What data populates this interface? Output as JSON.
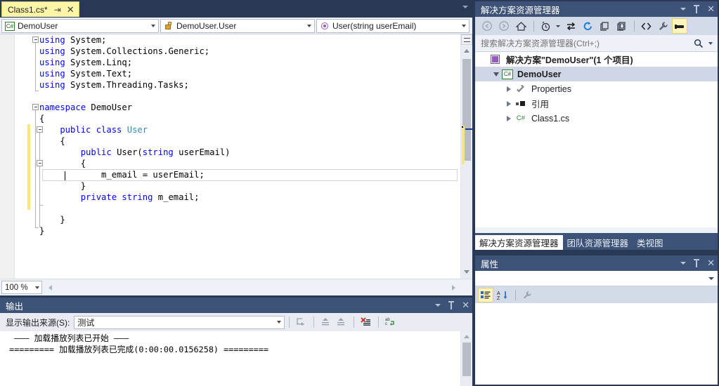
{
  "editor": {
    "tab": {
      "label": "Class1.cs*",
      "pin_icon": "pin-icon",
      "close_icon": "close-icon"
    },
    "navbar": {
      "type_combo": {
        "icon": "csharp-project-icon",
        "value": "DemoUser"
      },
      "class_combo": {
        "icon": "class-icon",
        "value": "DemoUser.User"
      },
      "member_combo": {
        "icon": "method-icon",
        "value": "User(string userEmail)"
      }
    },
    "code_lines": [
      [
        {
          "t": "using ",
          "c": "kw"
        },
        {
          "t": "System;",
          "c": "pl"
        }
      ],
      [
        {
          "t": "using ",
          "c": "kw"
        },
        {
          "t": "System.Collections.Generic;",
          "c": "pl"
        }
      ],
      [
        {
          "t": "using ",
          "c": "kw"
        },
        {
          "t": "System.Linq;",
          "c": "pl"
        }
      ],
      [
        {
          "t": "using ",
          "c": "kw"
        },
        {
          "t": "System.Text;",
          "c": "pl"
        }
      ],
      [
        {
          "t": "using ",
          "c": "kw"
        },
        {
          "t": "System.Threading.Tasks;",
          "c": "pl"
        }
      ],
      [],
      [
        {
          "t": "namespace ",
          "c": "kw"
        },
        {
          "t": "DemoUser",
          "c": "pl"
        }
      ],
      [
        {
          "t": "{",
          "c": "pl"
        }
      ],
      [
        {
          "t": "    public class ",
          "c": "kw"
        },
        {
          "t": "User",
          "c": "ty"
        }
      ],
      [
        {
          "t": "    {",
          "c": "pl"
        }
      ],
      [
        {
          "t": "        public ",
          "c": "kw"
        },
        {
          "t": "User(",
          "c": "pl"
        },
        {
          "t": "string ",
          "c": "kw"
        },
        {
          "t": "userEmail)",
          "c": "pl"
        }
      ],
      [
        {
          "t": "        {",
          "c": "pl"
        }
      ],
      [
        {
          "t": "            m_email = userEmail;",
          "c": "pl"
        }
      ],
      [
        {
          "t": "        }",
          "c": "pl"
        }
      ],
      [
        {
          "t": "        private string ",
          "c": "kw"
        },
        {
          "t": "m_email;",
          "c": "pl"
        }
      ],
      [],
      [
        {
          "t": "    }",
          "c": "pl"
        }
      ],
      [
        {
          "t": "}",
          "c": "pl"
        }
      ]
    ],
    "zoom_level": "100 %",
    "scroll_up_icon": "scroll-up-arrow-icon",
    "scroll_down_icon": "scroll-down-arrow-icon",
    "split_icon": "split-view-icon"
  },
  "output": {
    "title": "输出",
    "source_label": "显示输出来源(S):",
    "source_value": "测试",
    "lines": [
      "  ——— 加载播放列表已开始 ———",
      " ========= 加载播放列表已完成(0:00:00.0156258) ========="
    ],
    "toolbar": [
      {
        "name": "find-message-source-button",
        "glyph": "⇱"
      },
      {
        "name": "go-to-previous-message-button",
        "glyph": "↑"
      },
      {
        "name": "go-to-next-message-button",
        "glyph": "↓"
      },
      {
        "name": "clear-all-button",
        "glyph": "✖"
      },
      {
        "name": "toggle-word-wrap-button",
        "glyph": "⏎"
      }
    ],
    "window_controls": {
      "chevron_icon": "chevron-down-icon",
      "pin_icon": "pin-icon",
      "close_icon": "close-icon"
    }
  },
  "solution_explorer": {
    "title": "解决方案资源管理器",
    "search_placeholder": "搜索解决方案资源管理器(Ctrl+;)",
    "search_value": "",
    "toolbar": [
      {
        "name": "back-button",
        "glyph": "◀"
      },
      {
        "name": "forward-button",
        "glyph": "▶"
      },
      {
        "name": "home-button",
        "glyph": "⌂"
      },
      {
        "name": "pending-changes-filter-button",
        "glyph": "⏱"
      },
      {
        "name": "sync-with-active-document-button",
        "glyph": "⇆"
      },
      {
        "name": "refresh-button",
        "glyph": "⟳"
      },
      {
        "name": "collapse-all-button",
        "glyph": "▤"
      },
      {
        "name": "show-all-files-button",
        "glyph": "▣"
      },
      {
        "name": "view-code-button",
        "glyph": "<>"
      },
      {
        "name": "properties-button",
        "glyph": "🔧"
      },
      {
        "name": "preview-selected-items-button",
        "glyph": "▬"
      }
    ],
    "tree": [
      {
        "label": "解决方案\"DemoUser\"(1 个项目)",
        "icon": "solution-icon",
        "indent": 0,
        "expander": "expanded",
        "bold": true,
        "selected": false
      },
      {
        "label": "DemoUser",
        "icon": "csharp-project-icon",
        "indent": 1,
        "expander": "expanded",
        "bold": true,
        "selected": true
      },
      {
        "label": "Properties",
        "icon": "wrench-icon",
        "indent": 2,
        "expander": "collapsed",
        "bold": false,
        "selected": false
      },
      {
        "label": "引用",
        "icon": "references-icon",
        "indent": 2,
        "expander": "collapsed",
        "bold": false,
        "selected": false
      },
      {
        "label": "Class1.cs",
        "icon": "csharp-file-icon",
        "indent": 2,
        "expander": "collapsed",
        "bold": false,
        "selected": false
      }
    ],
    "window_controls": {
      "chevron_icon": "chevron-down-icon",
      "pin_icon": "pin-icon",
      "close_icon": "close-icon"
    },
    "tabs": [
      {
        "label": "解决方案资源管理器",
        "active": true
      },
      {
        "label": "团队资源管理器",
        "active": false
      },
      {
        "label": "类视图",
        "active": false
      }
    ]
  },
  "properties": {
    "title": "属性",
    "object_value": "",
    "toolbar": [
      {
        "name": "categorized-button",
        "glyph": "▤"
      },
      {
        "name": "alphabetical-button",
        "glyph": "AZ"
      },
      {
        "name": "property-pages-button",
        "glyph": "🔧"
      }
    ],
    "window_controls": {
      "chevron_icon": "chevron-down-icon",
      "pin_icon": "pin-icon",
      "close_icon": "close-icon"
    }
  },
  "colors": {
    "chrome": "#293955",
    "panel_header": "#3d5277",
    "toolbar": "#d3dae8",
    "tab_active": "#fcf4a6",
    "keyword": "#0000ff",
    "type": "#2b91af",
    "change_bar": "#f4e87a",
    "selection": "#cfd6e6"
  }
}
